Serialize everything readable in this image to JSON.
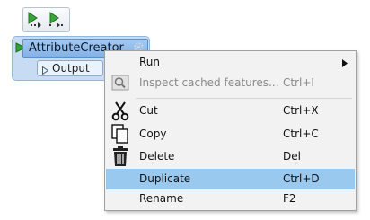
{
  "toolbar": {
    "buttons": [
      {
        "icon": "run-to-this-icon"
      },
      {
        "icon": "run-from-this-icon"
      }
    ]
  },
  "node": {
    "title": "AttributeCreator",
    "output_port": "Output",
    "color": "#c7dcf3"
  },
  "menu": {
    "items": [
      {
        "label": "Run",
        "shortcut": "",
        "submenu": true,
        "enabled": true,
        "icon": ""
      },
      {
        "label": "Inspect cached features...",
        "shortcut": "Ctrl+I",
        "enabled": false,
        "icon": "magnifier-icon"
      },
      {
        "label": "Cut",
        "shortcut": "Ctrl+X",
        "enabled": true,
        "icon": "scissors-icon"
      },
      {
        "label": "Copy",
        "shortcut": "Ctrl+C",
        "enabled": true,
        "icon": "copy-icon"
      },
      {
        "label": "Delete",
        "shortcut": "Del",
        "enabled": true,
        "icon": "trash-icon"
      },
      {
        "label": "Duplicate",
        "shortcut": "Ctrl+D",
        "enabled": true,
        "highlighted": true,
        "icon": ""
      },
      {
        "label": "Rename",
        "shortcut": "F2",
        "enabled": true,
        "icon": ""
      }
    ],
    "highlight_color": "#99c9ef"
  }
}
